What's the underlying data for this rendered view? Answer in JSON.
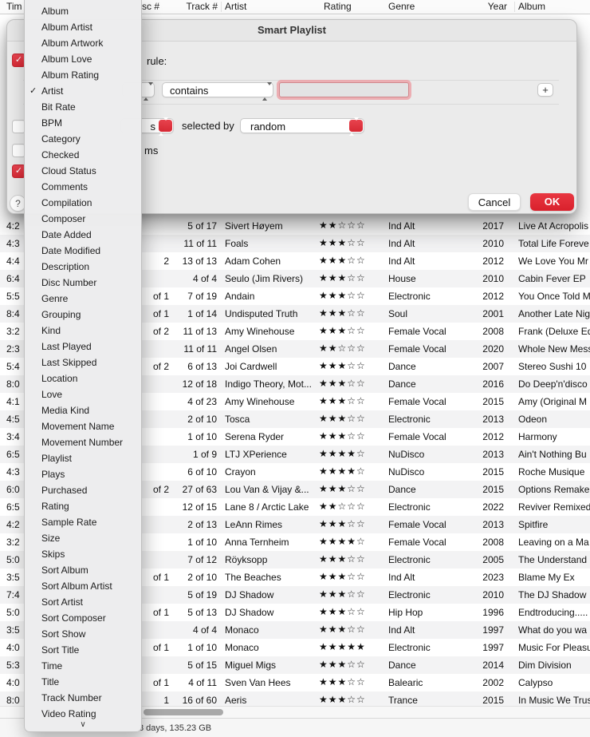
{
  "window": {
    "columns": [
      {
        "label": "Tim"
      },
      {
        "label": "sc #"
      },
      {
        "label": "Track #"
      },
      {
        "label": "Artist"
      },
      {
        "label": "Rating"
      },
      {
        "label": "Genre"
      },
      {
        "label": "Year"
      },
      {
        "label": "Album"
      }
    ],
    "status_bar": "3 days, 135.23 GB"
  },
  "dialog": {
    "title": "Smart Playlist",
    "match_label_fragment": "rule:",
    "rule": {
      "operator": "contains",
      "value": "",
      "add_label": "+"
    },
    "limit": {
      "unit_fragment": "s",
      "selected_by_label": "selected by",
      "selected_by_value": "random"
    },
    "checked_items_fragment": "ms",
    "help_label": "?",
    "cancel_label": "Cancel",
    "ok_label": "OK"
  },
  "menu": {
    "checked_item": "Artist",
    "more_indicator": "∨",
    "items": [
      "Album",
      "Album Artist",
      "Album Artwork",
      "Album Love",
      "Album Rating",
      "Artist",
      "Bit Rate",
      "BPM",
      "Category",
      "Checked",
      "Cloud Status",
      "Comments",
      "Compilation",
      "Composer",
      "Date Added",
      "Date Modified",
      "Description",
      "Disc Number",
      "Genre",
      "Grouping",
      "Kind",
      "Last Played",
      "Last Skipped",
      "Location",
      "Love",
      "Media Kind",
      "Movement Name",
      "Movement Number",
      "Playlist",
      "Plays",
      "Purchased",
      "Rating",
      "Sample Rate",
      "Size",
      "Skips",
      "Sort Album",
      "Sort Album Artist",
      "Sort Artist",
      "Sort Composer",
      "Sort Show",
      "Sort Title",
      "Time",
      "Title",
      "Track Number",
      "Video Rating"
    ]
  },
  "accent_colors": {
    "red": "#d62934",
    "star_red": "#e9384b"
  },
  "table": {
    "rows": [
      {
        "time": "4:2",
        "disc": "",
        "track": "5 of 17",
        "artist": "Sivert Høyem",
        "stars": 2,
        "genre": "Ind Alt",
        "year": "2017",
        "album": "Live At Acropolis"
      },
      {
        "time": "4:3",
        "disc": "",
        "track": "11 of 11",
        "artist": "Foals",
        "stars": 3,
        "genre": "Ind Alt",
        "year": "2010",
        "album": "Total Life Foreve"
      },
      {
        "time": "4:4",
        "disc": "2",
        "track": "13 of 13",
        "artist": "Adam Cohen",
        "stars": 3,
        "genre": "Ind Alt",
        "year": "2012",
        "album": "We Love You Mr"
      },
      {
        "time": "6:4",
        "disc": "",
        "track": "4 of 4",
        "artist": "Seulo (Jim Rivers)",
        "stars": 3,
        "genre": "House",
        "year": "2010",
        "album": "Cabin Fever EP"
      },
      {
        "time": "5:5",
        "disc": "of 1",
        "track": "7 of 19",
        "artist": "Andain",
        "stars": 3,
        "genre": "Electronic",
        "year": "2012",
        "album": "You Once Told M"
      },
      {
        "time": "8:4",
        "disc": "of 1",
        "track": "1 of 14",
        "artist": "Undisputed Truth",
        "stars": 3,
        "genre": "Soul",
        "year": "2001",
        "album": "Another Late Nig"
      },
      {
        "time": "3:2",
        "disc": "of 2",
        "track": "11 of 13",
        "artist": "Amy Winehouse",
        "stars": 3,
        "genre": "Female Vocal",
        "year": "2008",
        "album": "Frank (Deluxe Ed"
      },
      {
        "time": "2:3",
        "disc": "",
        "track": "11 of 11",
        "artist": "Angel Olsen",
        "stars": 2,
        "genre": "Female Vocal",
        "year": "2020",
        "album": "Whole New Mess"
      },
      {
        "time": "5:4",
        "disc": "of 2",
        "track": "6 of 13",
        "artist": "Joi Cardwell",
        "stars": 3,
        "genre": "Dance",
        "year": "2007",
        "album": "Stereo Sushi 10"
      },
      {
        "time": "8:0",
        "disc": "",
        "track": "12 of 18",
        "artist": "Indigo Theory, Mot...",
        "stars": 3,
        "genre": "Dance",
        "year": "2016",
        "album": "Do Deep'n'disco"
      },
      {
        "time": "4:1",
        "disc": "",
        "track": "4 of 23",
        "artist": "Amy Winehouse",
        "stars": 3,
        "genre": "Female Vocal",
        "year": "2015",
        "album": "Amy (Original M"
      },
      {
        "time": "4:5",
        "disc": "",
        "track": "2 of 10",
        "artist": "Tosca",
        "stars": 3,
        "genre": "Electronic",
        "year": "2013",
        "album": "Odeon"
      },
      {
        "time": "3:4",
        "disc": "",
        "track": "1 of 10",
        "artist": "Serena Ryder",
        "stars": 3,
        "genre": "Female Vocal",
        "year": "2012",
        "album": "Harmony"
      },
      {
        "time": "6:5",
        "disc": "",
        "track": "1 of 9",
        "artist": "LTJ XPerience",
        "stars": 4,
        "genre": "NuDisco",
        "year": "2013",
        "album": "Ain't Nothing Bu"
      },
      {
        "time": "4:3",
        "disc": "",
        "track": "6 of 10",
        "artist": "Crayon",
        "stars": 4,
        "genre": "NuDisco",
        "year": "2015",
        "album": "Roche Musique"
      },
      {
        "time": "6:0",
        "disc": "of 2",
        "track": "27 of 63",
        "artist": "Lou Van & Vijay &...",
        "stars": 3,
        "genre": "Dance",
        "year": "2015",
        "album": "Options Remake"
      },
      {
        "time": "6:5",
        "disc": "",
        "track": "12 of 15",
        "artist": "Lane 8 / Arctic Lake",
        "stars": 2,
        "genre": "Electronic",
        "year": "2022",
        "album": "Reviver Remixed"
      },
      {
        "time": "4:2",
        "disc": "",
        "track": "2 of 13",
        "artist": "LeAnn Rimes",
        "stars": 3,
        "genre": "Female Vocal",
        "year": "2013",
        "album": "Spitfire"
      },
      {
        "time": "3:2",
        "disc": "",
        "track": "1 of 10",
        "artist": "Anna Ternheim",
        "stars": 4,
        "genre": "Female Vocal",
        "year": "2008",
        "album": "Leaving on a Ma"
      },
      {
        "time": "5:0",
        "disc": "",
        "track": "7 of 12",
        "artist": "Röyksopp",
        "stars": 3,
        "genre": "Electronic",
        "year": "2005",
        "album": "The Understand"
      },
      {
        "time": "3:5",
        "disc": "of 1",
        "track": "2 of 10",
        "artist": "The Beaches",
        "stars": 3,
        "genre": "Ind Alt",
        "year": "2023",
        "album": "Blame My Ex"
      },
      {
        "time": "7:4",
        "disc": "",
        "track": "5 of 19",
        "artist": "DJ Shadow",
        "stars": 3,
        "genre": "Electronic",
        "year": "2010",
        "album": "The DJ Shadow"
      },
      {
        "time": "5:0",
        "disc": "of 1",
        "track": "5 of 13",
        "artist": "DJ Shadow",
        "stars": 3,
        "genre": "Hip Hop",
        "year": "1996",
        "album": "Endtroducing....."
      },
      {
        "time": "3:5",
        "disc": "",
        "track": "4 of 4",
        "artist": "Monaco",
        "stars": 3,
        "genre": "Ind Alt",
        "year": "1997",
        "album": "What do you wa"
      },
      {
        "time": "4:0",
        "disc": "of 1",
        "track": "1 of 10",
        "artist": "Monaco",
        "stars": 5,
        "genre": "Electronic",
        "year": "1997",
        "album": "Music For Pleasu"
      },
      {
        "time": "5:3",
        "disc": "",
        "track": "5 of 15",
        "artist": "Miguel Migs",
        "stars": 3,
        "genre": "Dance",
        "year": "2014",
        "album": "Dim Division"
      },
      {
        "time": "4:0",
        "disc": "of 1",
        "track": "4 of 11",
        "artist": "Sven Van Hees",
        "stars": 3,
        "genre": "Balearic",
        "year": "2002",
        "album": "Calypso"
      },
      {
        "time": "8:0",
        "disc": "1",
        "track": "16 of 60",
        "artist": "Aeris",
        "stars": 3,
        "genre": "Trance",
        "year": "2015",
        "album": "In Music We Trus"
      }
    ]
  }
}
